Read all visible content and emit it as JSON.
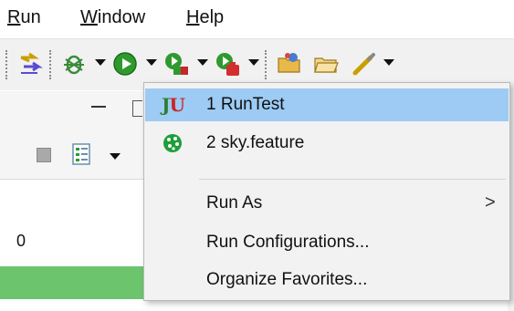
{
  "menubar": {
    "items": [
      {
        "label": "Run",
        "mnemonic": "R",
        "rest": "un"
      },
      {
        "label": "Window",
        "mnemonic": "W",
        "rest": "indow"
      },
      {
        "label": "Help",
        "mnemonic": "H",
        "rest": "elp"
      }
    ]
  },
  "toolbar": {
    "icons": [
      "step-filter-icon",
      "debug-icon",
      "run-icon",
      "coverage-icon",
      "external-tools-icon",
      "open-type-icon",
      "open-resource-icon",
      "search-icon"
    ]
  },
  "left_panel": {
    "count_value": "0"
  },
  "run_menu": {
    "items": [
      {
        "label": "1 RunTest",
        "icon": "junit-icon",
        "selected": true
      },
      {
        "label": "2 sky.feature",
        "icon": "cucumber-icon",
        "selected": false
      },
      {
        "label": "Run As",
        "icon": "",
        "submenu": true
      },
      {
        "label": "Run Configurations...",
        "icon": ""
      },
      {
        "label": "Organize Favorites...",
        "icon": ""
      }
    ],
    "submenu_arrow": ">"
  },
  "colors": {
    "selection": "#9dcbf4",
    "progress_green": "#6cc56c",
    "menu_bg": "#f2f2f2"
  }
}
